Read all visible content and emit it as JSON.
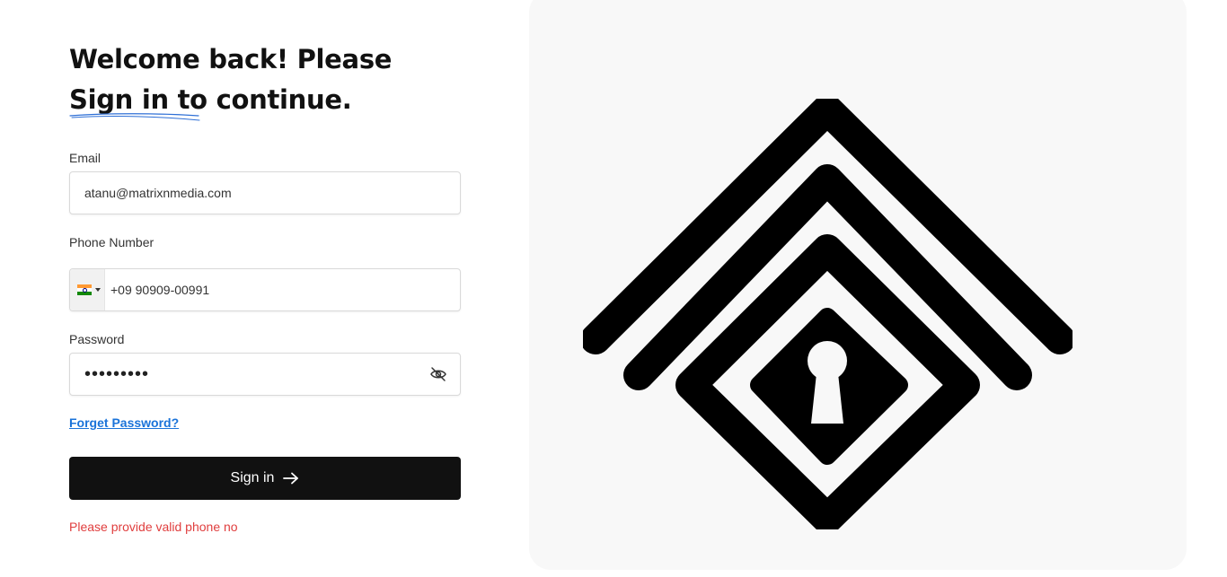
{
  "heading": {
    "line1": "Welcome back! Please",
    "line2_highlight": "Sign in",
    "line2_rest": " to continue."
  },
  "email": {
    "label": "Email",
    "value": "atanu@matrixnmedia.com"
  },
  "phone": {
    "label": "Phone Number",
    "country_flag": "india-flag-icon",
    "value": "+09 90909-00991"
  },
  "password": {
    "label": "Password",
    "masked_value": "•••••••••",
    "toggle_icon": "eye-off-icon"
  },
  "forgot_link": "Forget Password?",
  "signin_button": {
    "label": "Sign in",
    "icon": "arrow-right-icon"
  },
  "error_message": "Please provide valid phone no",
  "colors": {
    "primary_button": "#111111",
    "link": "#1a73d9",
    "error": "#e03e3e",
    "panel_background": "#f8f8f8"
  }
}
